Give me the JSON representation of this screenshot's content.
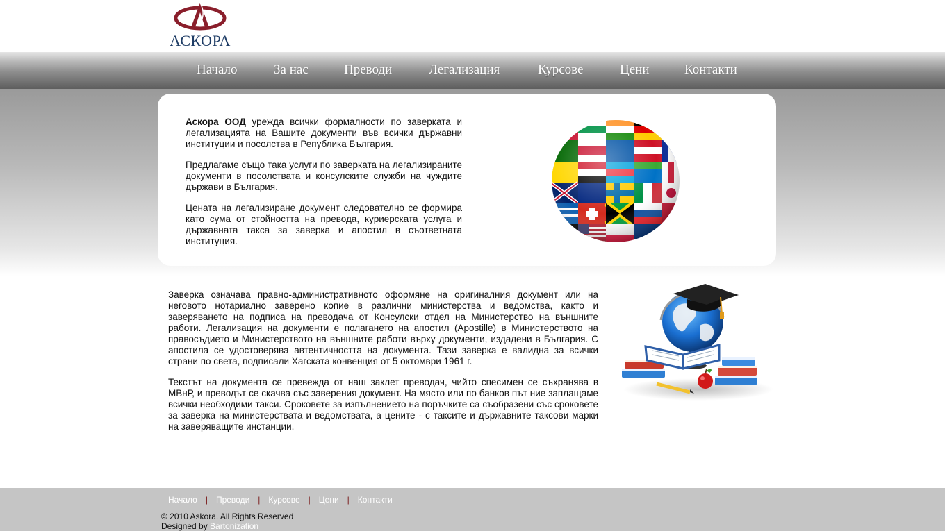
{
  "brand": {
    "logo_text": "АСКОРА",
    "logo_color": "#8a1e2b",
    "text_color": "#1f3d66"
  },
  "nav": {
    "items": [
      {
        "label": "Начало"
      },
      {
        "label": "За нас"
      },
      {
        "label": "Преводи"
      },
      {
        "label": "Легализация"
      },
      {
        "label": "Курсове"
      },
      {
        "label": "Цени"
      },
      {
        "label": "Контакти"
      }
    ]
  },
  "intro": {
    "company": "Аскора ООД",
    "p1_rest": " урежда всички формалности по заверката и легализацията на Вашите документи във всички държавни институции и посолства в Република България.",
    "p2": "Предлагаме също така услуги по заверката на легализираните документи в посолствата и консулските служби на чуждите държави в България.",
    "p3": "Цената на легализиране документ следователно се формира като сума от стойността на превода, куриерската услуга и държавната такса за заверка и апостил в съответната институция.",
    "image_icon": "flag-globe-icon"
  },
  "main": {
    "p1": "Заверка означава правно-административното оформяне на оригиналния документ или на неговото нотариално заверено копие в различни министерства и ведомства, както и заверяването на подписа на преводача от Консулски отдел на Министерство на външните работи. Легализация на документи е полагането на апостил (Apostille) в Министерството на правосъдието и Министерството на външните работи върху документи, издадени в България. С апостила се удостоверява автентичността на документа. Тази заверка е валидна за всички страни по света, подписали Хагската конвенция от 5 октомври 1961 г.",
    "p2": "Текстът на документа се превежда от наш заклет преводач, чийто спесимен се съхранява в МВнР, и преводът се скачва със заверения документ. На място или по банков път ние заплащаме всички необходими такси. Сроковете за изпълнението на поръчките са съобразени със сроковете за заверка на министерствата и ведомствата, а цените - с таксите и държавните таксови марки на заверяващите инстанции.",
    "image_icon": "education-globe-books-icon"
  },
  "footer": {
    "links": [
      {
        "label": "Начало"
      },
      {
        "label": "Преводи"
      },
      {
        "label": "Курсове"
      },
      {
        "label": "Цени"
      },
      {
        "label": "Контакти"
      }
    ],
    "separator": "|",
    "copyright": "© 2010 Askora. All Rights Reserved",
    "designed_by": "Designed by ",
    "designer": "Bartonization"
  }
}
